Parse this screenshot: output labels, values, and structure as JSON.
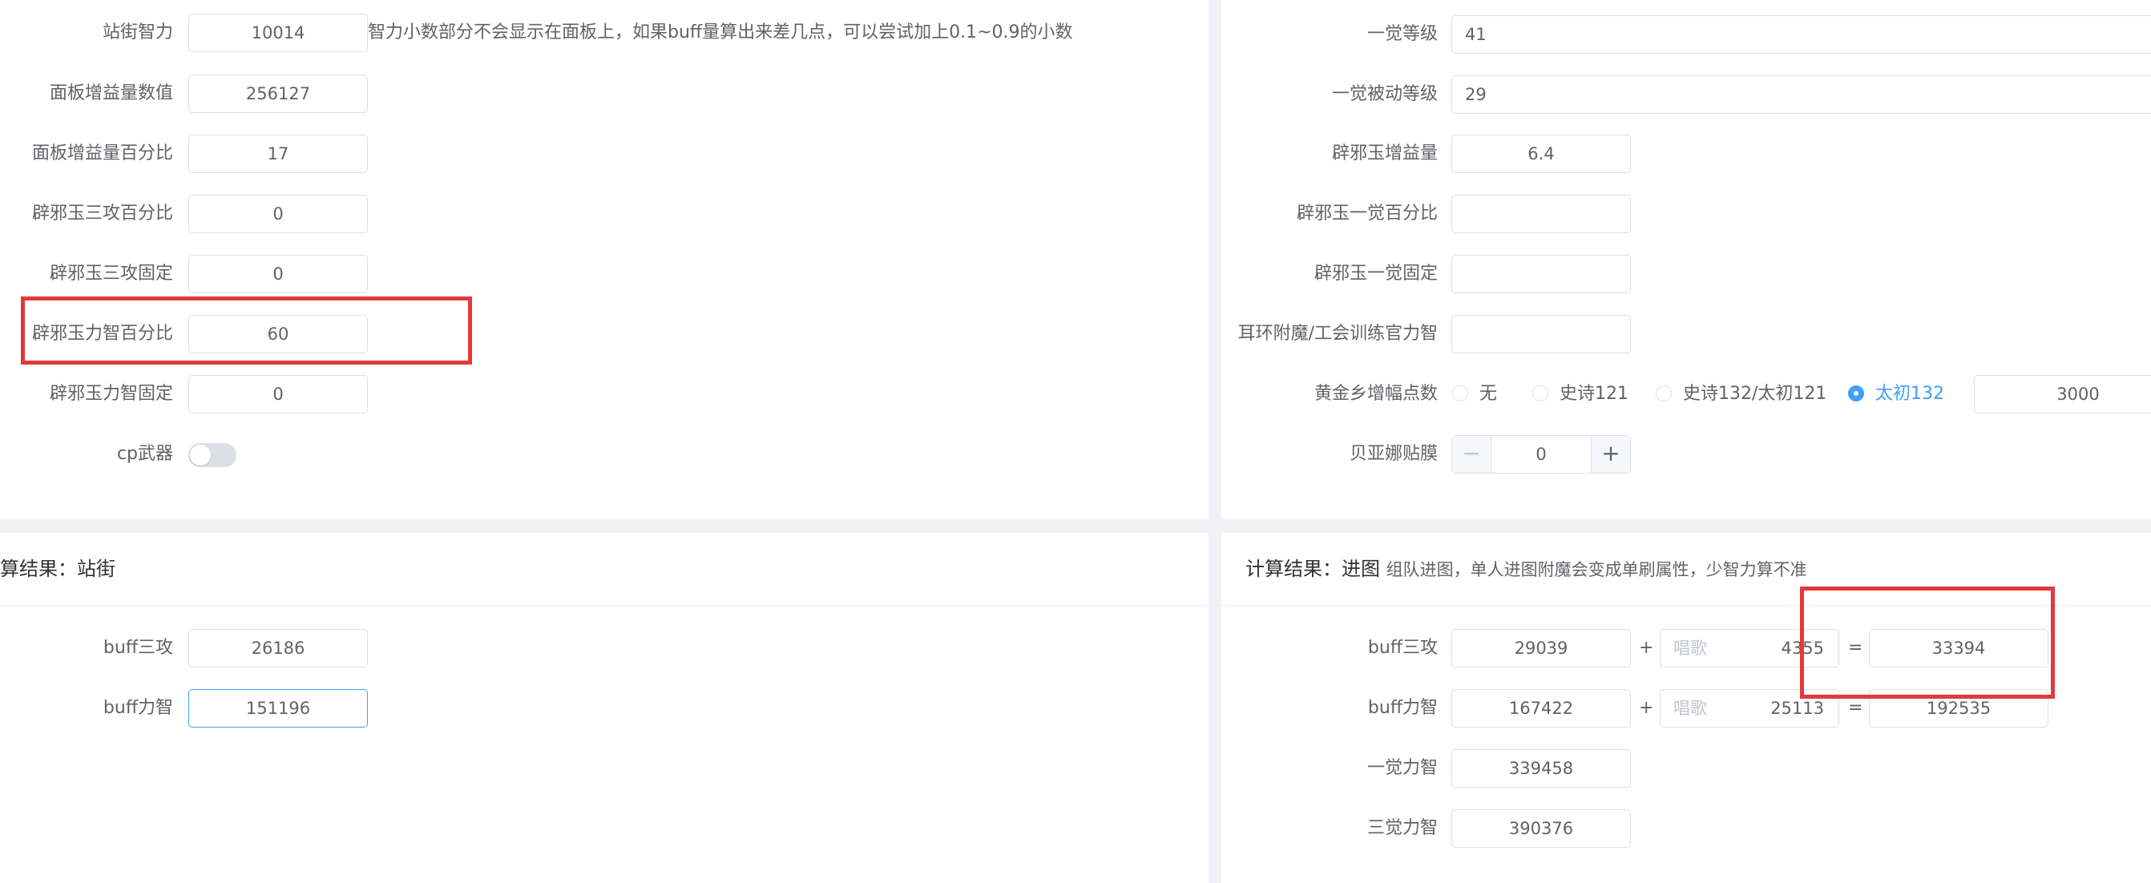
{
  "left_form": {
    "rows": [
      {
        "label": "站街智力",
        "value": "10014"
      },
      {
        "label": "面板增益量数值",
        "value": "256127"
      },
      {
        "label": "面板增益量百分比",
        "value": "17"
      },
      {
        "label": "辟邪玉三攻百分比",
        "value": "0"
      },
      {
        "label": "辟邪玉三攻固定",
        "value": "0"
      },
      {
        "label": "辟邪玉力智百分比",
        "value": "60"
      },
      {
        "label": "辟邪玉力智固定",
        "value": "0"
      }
    ],
    "hint": "智力小数部分不会显示在面板上，如果buff量算出来差几点，可以尝试加上0.1~0.9的小数",
    "cp_label": "cp武器"
  },
  "right_form": {
    "rows": [
      {
        "label": "一觉等级",
        "value": "41"
      },
      {
        "label": "一觉被动等级",
        "value": "29"
      },
      {
        "label": "辟邪玉增益量",
        "value": "6.4"
      },
      {
        "label": "辟邪玉一觉百分比",
        "value": ""
      },
      {
        "label": "辟邪玉一觉固定",
        "value": ""
      },
      {
        "label": "耳环附魔/工会训练官力智",
        "value": ""
      }
    ],
    "gold": {
      "label": "黄金乡增幅点数",
      "options": [
        "无",
        "史诗121",
        "史诗132/太初121",
        "太初132"
      ],
      "selected": "太初132",
      "value": "3000"
    },
    "beiyana": {
      "label": "贝亚娜贴膜",
      "value": "0",
      "minus": "−",
      "plus": "+"
    }
  },
  "left_result": {
    "title": "算结果：站街",
    "rows": [
      {
        "label": "buff三攻",
        "value": "26186"
      },
      {
        "label": "buff力智",
        "value": "151196"
      }
    ]
  },
  "right_result": {
    "title": "计算结果：进图",
    "subtitle": "组队进图，单人进图附魔会变成单刷属性，少智力算不准",
    "ops": {
      "plus": "+",
      "eq": "="
    },
    "rows": [
      {
        "label": "buff三攻",
        "base": "29039",
        "prefix": "唱歌",
        "song": "4355",
        "total": "33394"
      },
      {
        "label": "buff力智",
        "base": "167422",
        "prefix": "唱歌",
        "song": "25113",
        "total": "192535"
      }
    ],
    "extra": [
      {
        "label": "一觉力智",
        "value": "339458"
      },
      {
        "label": "三觉力智",
        "value": "390376"
      }
    ]
  },
  "colors": {
    "highlight": "#e3393c",
    "accent": "#409eff",
    "border": "#dcdfe6",
    "background": "#f0f2f5"
  }
}
